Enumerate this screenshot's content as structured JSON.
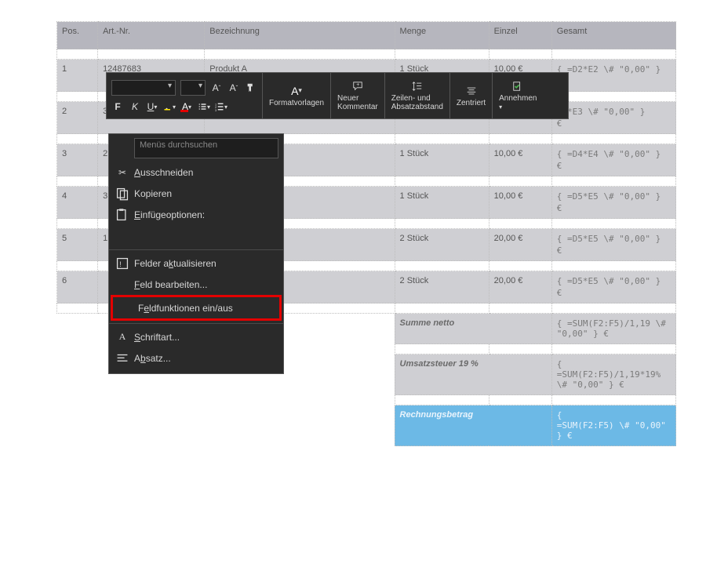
{
  "header": {
    "pos": "Pos.",
    "art": "Art.-Nr.",
    "bez": "Bezeichnung",
    "menge": "Menge",
    "einzel": "Einzel",
    "gesamt": "Gesamt"
  },
  "rows": [
    {
      "pos": "1",
      "art": "12487683",
      "bez": "Produkt A",
      "menge": "1 Stück",
      "einzel": "10,00 €",
      "formula": "{ =D2*E2 \\# \"0,00\" }"
    },
    {
      "pos": "2",
      "art": "3",
      "bez": "",
      "menge": "",
      "einzel": "",
      "formula": "D3*E3 \\# \"0,00\" }"
    },
    {
      "pos": "3",
      "art": "2",
      "bez": "",
      "menge": "1 Stück",
      "einzel": "10,00 €",
      "formula": "{ =D4*E4 \\# \"0,00\" }"
    },
    {
      "pos": "4",
      "art": "3",
      "bez": "",
      "menge": "1 Stück",
      "einzel": "10,00 €",
      "formula": "{ =D5*E5 \\# \"0,00\" }"
    },
    {
      "pos": "5",
      "art": "1",
      "bez": "",
      "menge": "2 Stück",
      "einzel": "20,00 €",
      "formula": "{ =D5*E5 \\# \"0,00\" }"
    },
    {
      "pos": "6",
      "art": "",
      "bez": "",
      "menge": "2 Stück",
      "einzel": "20,00 €",
      "formula": "{ =D5*E5 \\# \"0,00\" }"
    }
  ],
  "euro": "€",
  "summary": {
    "netto_label": "Summe netto",
    "netto_formula": "{ =SUM(F2:F5)/1,19 \\# \"0,00\" } €",
    "vat_label": "Umsatzsteuer 19 %",
    "vat_formula_l1": "{",
    "vat_formula_l2": "=SUM(F2:F5)/1,19*19% \\# \"0,00\" } €",
    "total_label": "Rechnungsbetrag",
    "total_formula_l1": "{",
    "total_formula_l2": "=SUM(F2:F5) \\# \"0,00\" } €"
  },
  "toolbar": {
    "formatvorlagen": "Formatvorlagen",
    "neuer_kommentar_l1": "Neuer",
    "neuer_kommentar_l2": "Kommentar",
    "zeilen_l1": "Zeilen- und",
    "zeilen_l2": "Absatzabstand",
    "zentriert": "Zentriert",
    "annehmen": "Annehmen",
    "bold": "F",
    "italic": "K",
    "underline": "U"
  },
  "context": {
    "search_placeholder": "Menüs durchsuchen",
    "cut": "Ausschneiden",
    "copy": "Kopieren",
    "paste_opts": "Einfügeoptionen:",
    "update_fields": "Felder aktualisieren",
    "edit_field": "Feld bearbeiten...",
    "toggle_fields": "Feldfunktionen ein/aus",
    "font": "Schriftart...",
    "paragraph": "Absatz..."
  }
}
